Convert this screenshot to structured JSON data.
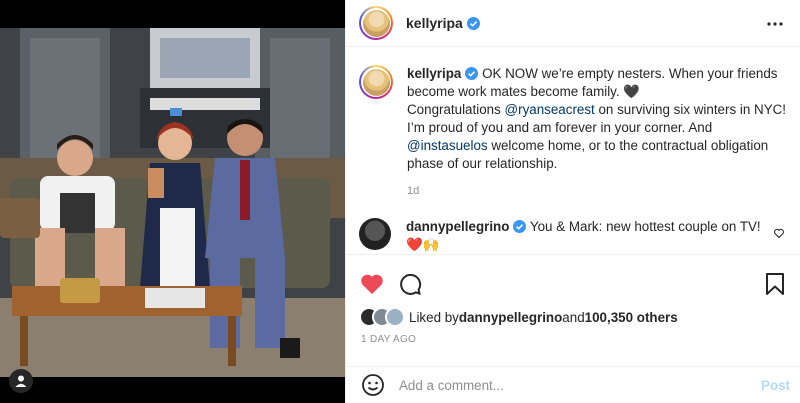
{
  "post": {
    "image_alt": "Four people posing on a vintage TV show set"
  },
  "header": {
    "username": "kellyripa",
    "verified": true,
    "more_icon": "more-horizontal-icon"
  },
  "caption": {
    "username": "kellyripa",
    "text_1": " OK NOW we’re empty nesters. When your friends become work mates become family. 🖤",
    "text_2": "Congratulations ",
    "mention_1": "@ryanseacrest",
    "text_3": " on surviving six winters in NYC! I’m proud of you and am forever in your corner. And ",
    "mention_2": "@instasuelos",
    "text_4": " welcome home, or to the contractual obligation phase of our relationship.",
    "time": "1d"
  },
  "comments": [
    {
      "username": "dannypellegrino",
      "verified": true,
      "text": " You & Mark: new hottest couple on TV! ❤️🙌"
    }
  ],
  "actions": {
    "like_icon": "heart-filled-icon",
    "comment_icon": "comment-bubble-icon",
    "bookmark_icon": "bookmark-icon",
    "liked": true,
    "like_color": "#ed4956"
  },
  "likes": {
    "prefix": "Liked by ",
    "user": "dannypellegrino",
    "middle": " and ",
    "count": "100,350 others"
  },
  "posted": "1 DAY AGO",
  "add_comment": {
    "placeholder": "Add a comment...",
    "post_label": "Post",
    "emoji_icon": "smiley-icon"
  },
  "colors": {
    "link": "#00376b",
    "verified": "#3897f0",
    "post_disabled": "#b3dbff",
    "muted": "#8e8e8e"
  }
}
